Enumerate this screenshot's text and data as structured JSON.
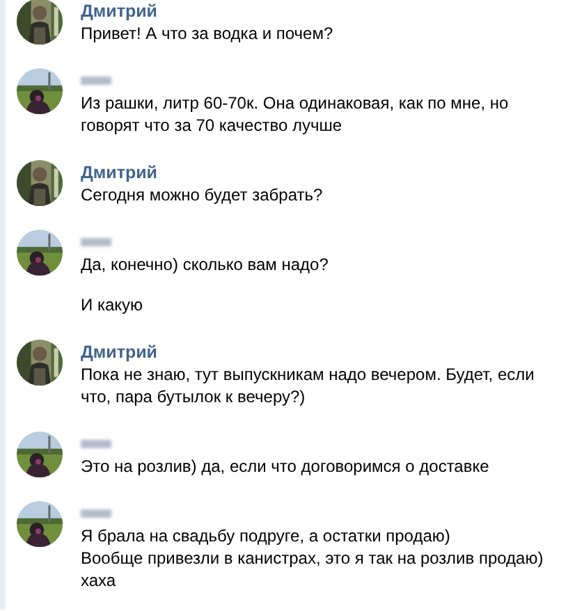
{
  "groups": [
    {
      "author": "Дмитрий",
      "redacted": false,
      "messages": [
        {
          "text": "Привет! А что за водка и почем?"
        }
      ]
    },
    {
      "redacted": true,
      "messages": [
        {
          "text": "Из рашки, литр 60-70к. Она одинаковая, как по мне, но говорят что за 70 качество лучше"
        }
      ]
    },
    {
      "author": "Дмитрий",
      "redacted": false,
      "messages": [
        {
          "text": "Сегодня можно будет забрать?"
        }
      ]
    },
    {
      "redacted": true,
      "messages": [
        {
          "text": "Да, конечно) сколько вам надо?"
        },
        {
          "text": "И какую"
        }
      ]
    },
    {
      "author": "Дмитрий",
      "redacted": false,
      "messages": [
        {
          "text": "Пока не знаю, тут выпускникам надо вечером. Будет, если что, пара бутылок к вечеру?)"
        }
      ]
    },
    {
      "redacted": true,
      "messages": [
        {
          "text": "Это на розлив) да, если что договоримся о доставке"
        }
      ]
    },
    {
      "redacted": true,
      "messages": [
        {
          "text": "Я брала на свадьбу подруге, а остатки продаю)\nВообще привезли в канистрах, это я так на розлив продаю)\nхаха"
        }
      ]
    }
  ]
}
